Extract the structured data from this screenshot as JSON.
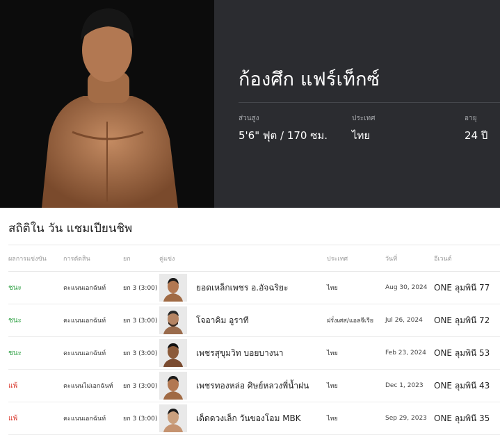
{
  "fighter": {
    "name": "ก้องศึก แฟร์เท็กซ์",
    "stats": [
      {
        "label": "ส่วนสูง",
        "value": "5'6\" ฟุต / 170 ซม."
      },
      {
        "label": "ประเทศ",
        "value": "ไทย"
      },
      {
        "label": "อายุ",
        "value": "24 ปี"
      }
    ]
  },
  "record": {
    "title": "สถิติใน วัน แชมเปียนชิพ",
    "headers": [
      "ผลการแข่งขัน",
      "การตัดสิน",
      "ยก",
      "คู่แข่ง",
      "ประเทศ",
      "วันที่",
      "อีเวนต์"
    ],
    "rows": [
      {
        "result": "ชนะ",
        "outcome": "win",
        "method": "คะแนนเอกฉันท์",
        "round": "ยก 3 (3:00)",
        "opponent": "ยอดเหล็กเพชร อ.อัจฉริยะ",
        "country": "ไทย",
        "date": "Aug 30, 2024",
        "event": "ONE ลุมพินี 77"
      },
      {
        "result": "ชนะ",
        "outcome": "win",
        "method": "คะแนนเอกฉันท์",
        "round": "ยก 3 (3:00)",
        "opponent": "โจอาคิม อูราที",
        "country": "ฝรั่งเศส/แอลจีเรีย",
        "date": "Jul 26, 2024",
        "event": "ONE ลุมพินี 72"
      },
      {
        "result": "ชนะ",
        "outcome": "win",
        "method": "คะแนนเอกฉันท์",
        "round": "ยก 3 (3:00)",
        "opponent": "เพชรสุขุมวิท บอยบางนา",
        "country": "ไทย",
        "date": "Feb 23, 2024",
        "event": "ONE ลุมพินี 53"
      },
      {
        "result": "แพ้",
        "outcome": "loss",
        "method": "คะแนนไม่เอกฉันท์",
        "round": "ยก 3 (3:00)",
        "opponent": "เพชรทองหล่อ ศิษย์หลวงพี่น้ำฝน",
        "country": "ไทย",
        "date": "Dec 1, 2023",
        "event": "ONE ลุมพินี 43"
      },
      {
        "result": "แพ้",
        "outcome": "loss",
        "method": "คะแนนเอกฉันท์",
        "round": "ยก 3 (3:00)",
        "opponent": "เด็ดดวงเล็ก วันของโอม MBK",
        "country": "ไทย",
        "date": "Sep 29, 2023",
        "event": "ONE ลุมพินี 35"
      }
    ]
  },
  "colors": {
    "win": "#2ea043",
    "loss": "#d9382d",
    "hero_panel": "#2b2c30"
  }
}
